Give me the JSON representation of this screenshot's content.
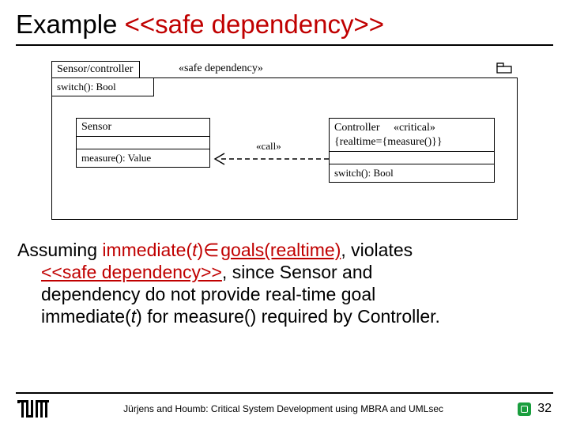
{
  "title": {
    "prefix": "Example ",
    "red": "<<safe dependency>>"
  },
  "diagram": {
    "package_name": "Sensor/controller",
    "package_stereotype": "«safe dependency»",
    "package_op": "switch(): Bool",
    "call_label": "«call»",
    "sensor": {
      "name": "Sensor",
      "op": "measure(): Value"
    },
    "controller": {
      "name": "Controller",
      "stereotype": "«critical»",
      "tag": "{realtime={measure()}}",
      "op": "switch(): Bool"
    }
  },
  "body": {
    "l1a": "Assuming ",
    "l1b": "immediate(",
    "l1c": "t",
    "l1d": ")",
    "l1e": "∈",
    "l1f": "goals(realtime)",
    "l1g": ", violates",
    "l2a": "<<safe dependency>>",
    "l2b": ", since Sensor and",
    "l3": "dependency do not provide real-time goal",
    "l4a": "immediate(",
    "l4b": "t",
    "l4c": ") for measure() required by Controller."
  },
  "footer": {
    "text": "Jürjens and Houmb: Critical System Development using MBRA and UMLsec",
    "page": "32"
  }
}
